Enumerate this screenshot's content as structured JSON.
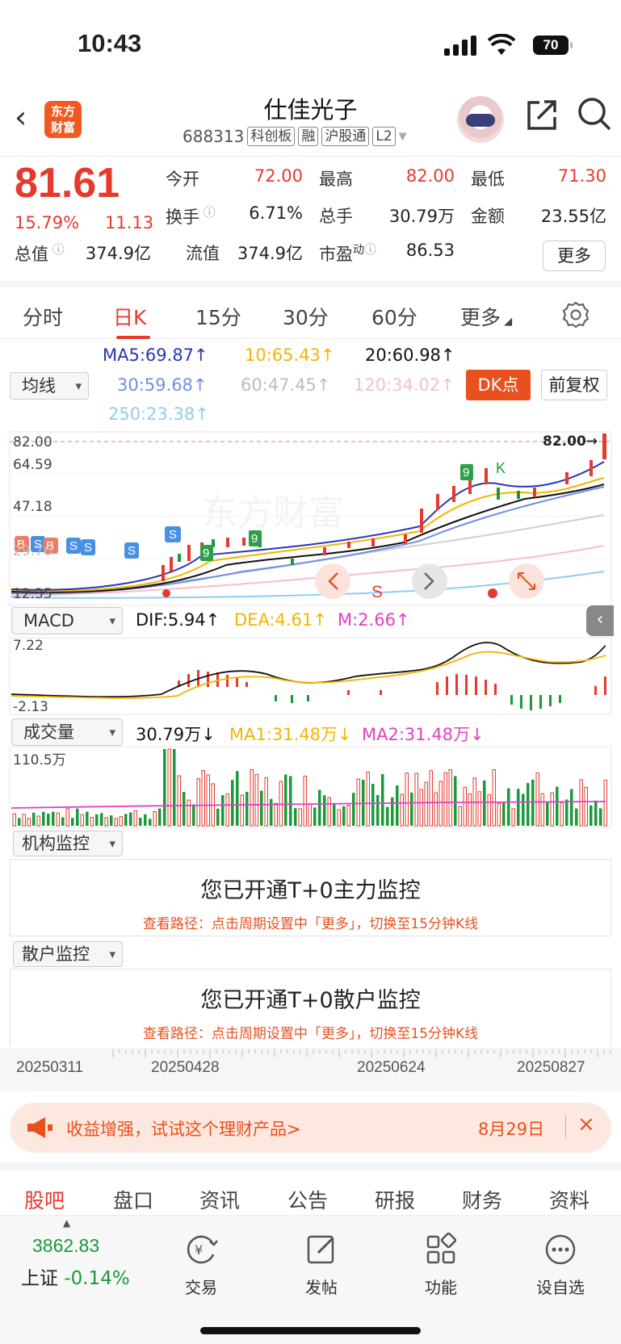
{
  "status": {
    "time": "10:43",
    "battery": "70"
  },
  "header": {
    "logo_line1": "东方",
    "logo_line2": "财富",
    "name": "仕佳光子",
    "code": "688313",
    "tags": [
      "科创板",
      "融",
      "沪股通",
      "L2"
    ]
  },
  "quote": {
    "price": "81.61",
    "pct": "15.79%",
    "change": "11.13",
    "labels": {
      "open": "今开",
      "high": "最高",
      "low": "最低",
      "turnover": "换手",
      "volume": "总手",
      "amount": "金额",
      "mktcap": "总值",
      "float": "流值",
      "pe": "市盈",
      "pe_sup": "动"
    },
    "open": "72.00",
    "high": "82.00",
    "low": "71.30",
    "turnover": "6.71%",
    "volume": "30.79万",
    "amount": "23.55亿",
    "mktcap": "374.9亿",
    "float": "374.9亿",
    "pe": "86.53",
    "more": "更多"
  },
  "periods": [
    "分时",
    "日K",
    "15分",
    "30分",
    "60分",
    "更多"
  ],
  "ma": {
    "selector": "均线",
    "ma5": "MA5:69.87↑",
    "ma10": "10:65.43↑",
    "ma20": "20:60.98↑",
    "ma30": "30:59.68↑",
    "ma60": "60:47.45↑",
    "ma120": "120:34.02↑",
    "ma250": "250:23.38↑",
    "dk": "DK点",
    "fq": "前复权",
    "colors": {
      "ma5": "#2636b8",
      "ma10": "#f4b400",
      "ma20": "#111111",
      "ma30": "#6f8fe6",
      "ma60": "#bdbdbd",
      "ma120": "#f6bcd0",
      "ma250": "#8fcdf2"
    }
  },
  "kchart": {
    "y_labels": [
      "82.00",
      "64.59",
      "47.18",
      "29.76",
      "12.35"
    ],
    "high_marker": "82.00→",
    "signal_s": "S",
    "signal_k": "K",
    "signal_b": "B"
  },
  "macd": {
    "selector": "MACD",
    "dif": "DIF:5.94↑",
    "dea": "DEA:4.61↑",
    "m": "M:2.66↑",
    "y_top": "7.22",
    "y_bottom": "-2.13"
  },
  "vol": {
    "selector": "成交量",
    "value": "30.79万↓",
    "ma1": "MA1:31.48万↓",
    "ma2": "MA2:31.48万↓",
    "y_top": "110.5万"
  },
  "monitors": [
    {
      "selector": "机构监控",
      "title": "您已开通T+0主力监控",
      "sub": "查看路径：点击周期设置中「更多」，切换至15分钟K线"
    },
    {
      "selector": "散户监控",
      "title": "您已开通T+0散户监控",
      "sub": "查看路径：点击周期设置中「更多」，切换至15分钟K线"
    }
  ],
  "dates": [
    "20250311",
    "20250428",
    "20250624",
    "20250827"
  ],
  "promo": {
    "text": "收益增强，试试这个理财产品>",
    "date": "8月29日"
  },
  "section_tabs": [
    "股吧",
    "盘口",
    "资讯",
    "公告",
    "研报",
    "财务",
    "资料"
  ],
  "bottom": {
    "index_value": "3862.83",
    "index_name": "上证",
    "index_change": "-0.14%",
    "items": [
      "交易",
      "发帖",
      "功能",
      "设自选"
    ]
  },
  "chart_data": {
    "type": "candlestick",
    "y_range": [
      12.35,
      82.0
    ],
    "last_close": 81.61,
    "macd_range": [
      -2.13,
      7.22
    ],
    "volume_max_wan": 110.5
  }
}
